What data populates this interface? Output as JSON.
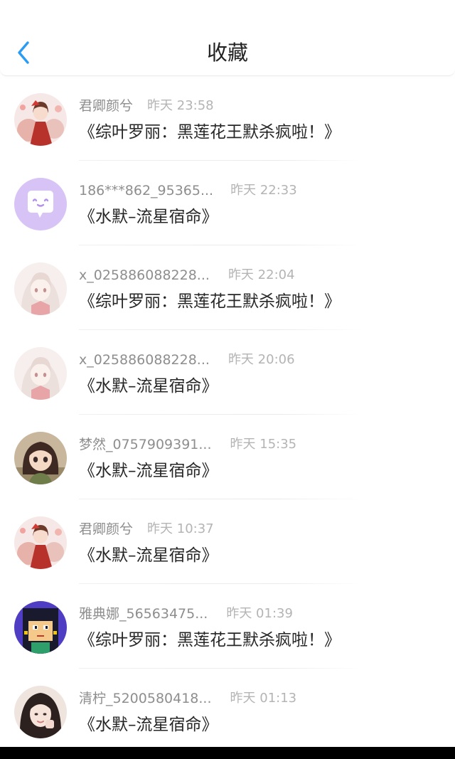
{
  "header": {
    "title": "收藏",
    "back_icon": "chevron-left-icon",
    "accent_color": "#2a9cf4"
  },
  "items": [
    {
      "username": "君卿颜兮",
      "time": "昨天 23:58",
      "book": "《综叶罗丽：黑莲花王默杀疯啦！》",
      "avatar": "anime-girl-red-avatar"
    },
    {
      "username": "186***862_95365...",
      "time": "昨天 22:33",
      "book": "《水默–流星宿命》",
      "avatar": "default-chat-avatar"
    },
    {
      "username": "x_025886088228...",
      "time": "昨天 22:04",
      "book": "《综叶罗丽：黑莲花王默杀疯啦！》",
      "avatar": "anime-girl-pale-avatar"
    },
    {
      "username": "x_025886088228...",
      "time": "昨天 20:06",
      "book": "《水默–流星宿命》",
      "avatar": "anime-girl-pale-avatar"
    },
    {
      "username": "梦然_0757909391...",
      "time": "昨天 15:35",
      "book": "《水默–流星宿命》",
      "avatar": "doll-girl-avatar"
    },
    {
      "username": "君卿颜兮",
      "time": "昨天 10:37",
      "book": "《水默–流星宿命》",
      "avatar": "anime-girl-red-avatar"
    },
    {
      "username": "雅典娜_56563475...",
      "time": "昨天 01:39",
      "book": "《综叶罗丽：黑莲花王默杀疯啦！》",
      "avatar": "pixel-girl-avatar"
    },
    {
      "username": "清柠_5200580418...",
      "time": "昨天 01:13",
      "book": "《水默–流星宿命》",
      "avatar": "photo-girl-avatar"
    }
  ]
}
